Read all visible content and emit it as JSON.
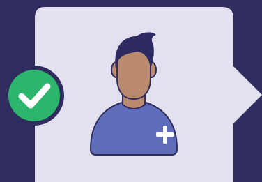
{
  "illustration": {
    "card": {
      "icon": "user-profile-card"
    },
    "badge": {
      "icon": "check-icon",
      "status": "verified"
    },
    "avatar": {
      "icon": "person-icon"
    },
    "action": {
      "icon": "plus-icon"
    }
  },
  "colors": {
    "background": "#2f2d5e",
    "card": "#e3e0f0",
    "badge_ring": "#2f2d5e",
    "badge_fill": "#2db56c",
    "skin": "#b98a6e",
    "hair": "#2e2b63",
    "shirt": "#5e6cba",
    "outline": "#2f2d5e",
    "plus": "#ffffff"
  }
}
